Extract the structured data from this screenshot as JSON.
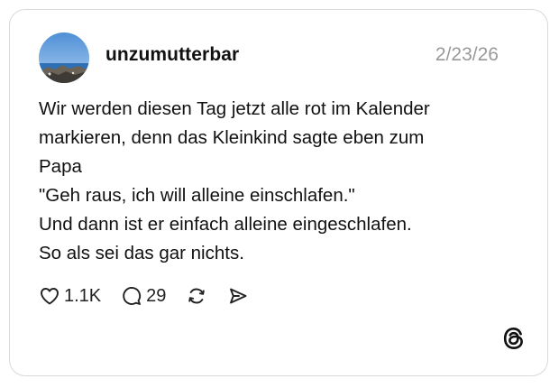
{
  "post": {
    "username": "unzumutterbar",
    "date": "2/23/26",
    "text_lines": [
      "Wir werden diesen Tag jetzt alle rot im Kalender",
      "markieren, denn das Kleinkind sagte eben zum",
      "Papa",
      "\"Geh raus, ich will alleine einschlafen.\"",
      "Und dann ist er einfach alleine eingeschlafen.",
      "So als sei das gar nichts."
    ]
  },
  "actions": {
    "like": {
      "icon": "heart-icon",
      "count": "1.1K"
    },
    "reply": {
      "icon": "comment-icon",
      "count": "29"
    },
    "repost": {
      "icon": "repost-icon"
    },
    "share": {
      "icon": "send-icon"
    }
  },
  "branding": {
    "logo": "threads-logo-icon"
  }
}
